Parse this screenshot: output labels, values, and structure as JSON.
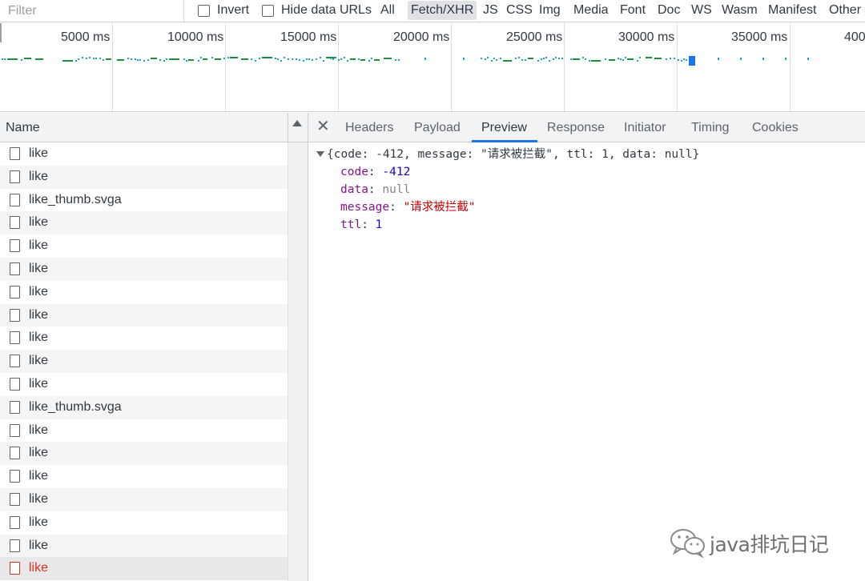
{
  "filter": {
    "placeholder": "Filter"
  },
  "checks": {
    "invert": "Invert",
    "hide_data_urls": "Hide data URLs"
  },
  "types": [
    "All",
    "Fetch/XHR",
    "JS",
    "CSS",
    "Img",
    "Media",
    "Font",
    "Doc",
    "WS",
    "Wasm",
    "Manifest",
    "Other"
  ],
  "active_type": "Fetch/XHR",
  "overview": {
    "ticks": [
      "5000 ms",
      "10000 ms",
      "15000 ms",
      "20000 ms",
      "25000 ms",
      "30000 ms",
      "35000 ms",
      "400"
    ]
  },
  "list": {
    "header": "Name",
    "rows": [
      "like",
      "like",
      "like_thumb.svga",
      "like",
      "like",
      "like",
      "like",
      "like",
      "like",
      "like",
      "like",
      "like_thumb.svga",
      "like",
      "like",
      "like",
      "like",
      "like",
      "like",
      "like"
    ]
  },
  "tabs": [
    "Headers",
    "Payload",
    "Preview",
    "Response",
    "Initiator",
    "Timing",
    "Cookies"
  ],
  "active_tab": "Preview",
  "preview": {
    "summary": "{code: -412, message: \"请求被拦截\", ttl: 1, data: null}",
    "props": [
      {
        "key": "code",
        "value": "-412",
        "kind": "number"
      },
      {
        "key": "data",
        "value": "null",
        "kind": "null"
      },
      {
        "key": "message",
        "value": "\"请求被拦截\"",
        "kind": "string"
      },
      {
        "key": "ttl",
        "value": "1",
        "kind": "number"
      }
    ]
  },
  "watermark": {
    "text": "java排坑日记"
  },
  "colors": {
    "active_tab": "#1a73e8",
    "error": "#d93025",
    "key": "#881391",
    "number": "#1c00cf",
    "string": "#c80000",
    "blip_blue": "#1aa3c4",
    "blip_green": "#1e8e3e"
  }
}
